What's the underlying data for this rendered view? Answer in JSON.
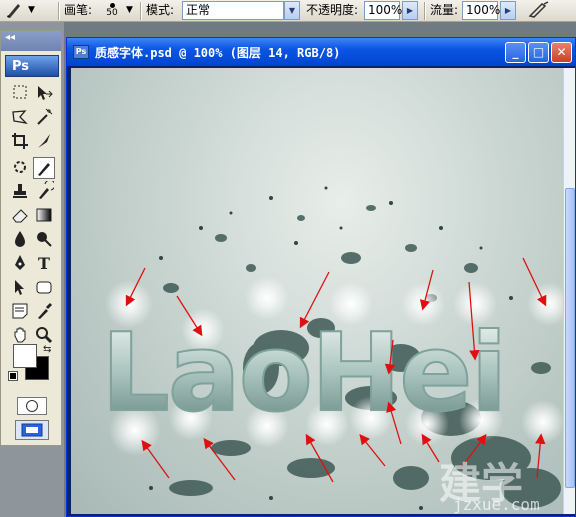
{
  "options_bar": {
    "brush_label": "画笔:",
    "brush_size": "50",
    "mode_label": "模式:",
    "mode_value": "正常",
    "opacity_label": "不透明度:",
    "opacity_value": "100%",
    "flow_label": "流量:",
    "flow_value": "100%"
  },
  "toolbox": {
    "title_glyph": "◂◂",
    "logo": "Ps"
  },
  "document": {
    "title": "质感字体.psd @ 100% (图层 14, RGB/8)",
    "icon_text": "Ps",
    "artwork_text": "LaoHei",
    "watermark_text": "jzxue.com"
  },
  "colors": {
    "title_bar": "#0a55e4",
    "canvas_bg": "#c9d5d1",
    "splatter": "#3f5a55",
    "arrow": "#e01010"
  }
}
